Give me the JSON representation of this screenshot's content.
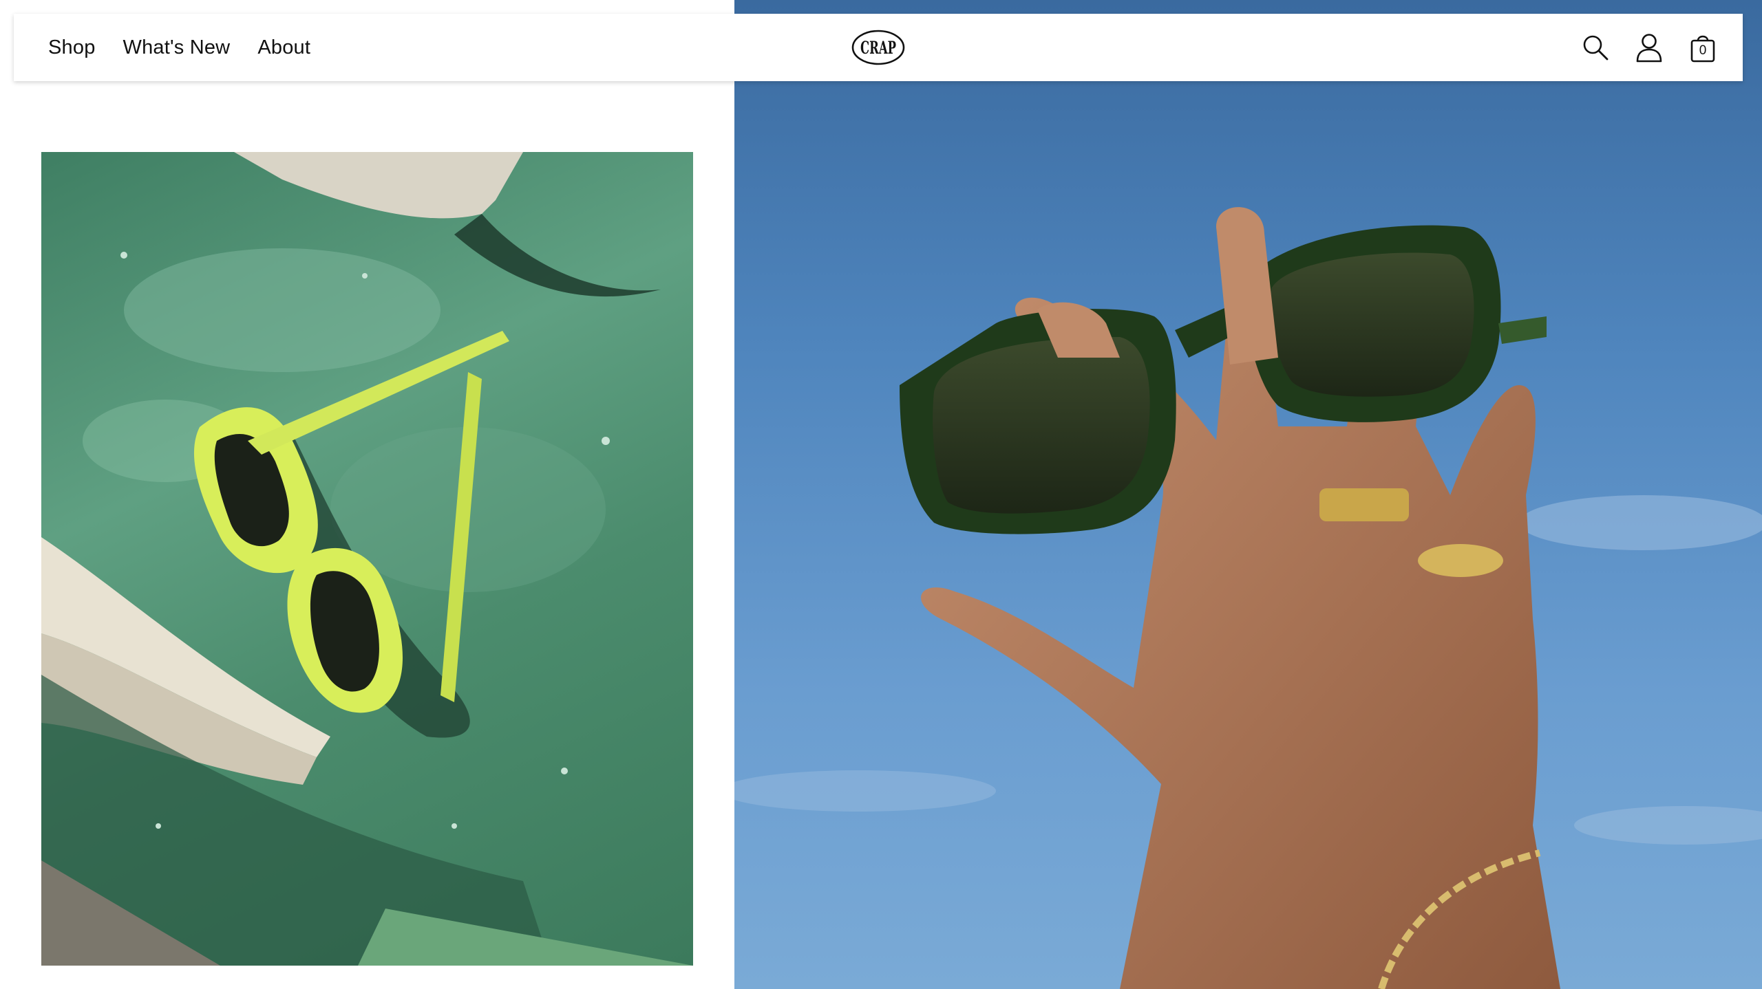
{
  "nav": {
    "items": [
      {
        "label": "Shop"
      },
      {
        "label": "What's New"
      },
      {
        "label": "About"
      }
    ]
  },
  "logo": {
    "text": "CRAP"
  },
  "header_icons": {
    "search": "search-icon",
    "account": "user-icon",
    "cart": "bag-icon"
  },
  "cart": {
    "count": "0"
  },
  "colors": {
    "header_bg": "#ffffff",
    "text": "#111111",
    "sky": "#4f85bd",
    "surf_green": "#4b8c6d",
    "frame_lime": "#d8ee5a",
    "frame_green": "#1f3a1a"
  }
}
